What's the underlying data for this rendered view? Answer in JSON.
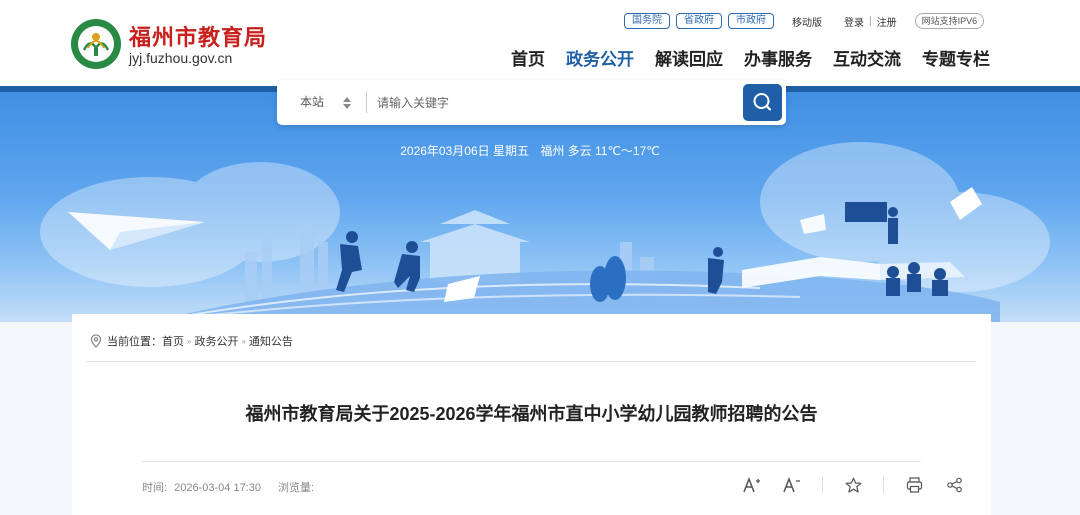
{
  "header": {
    "site_name": "福州市教育局",
    "site_domain": "jyj.fuzhou.gov.cn",
    "gov_links": [
      "国务院",
      "省政府",
      "市政府"
    ],
    "mobile": "移动版",
    "login": "登录",
    "separator": "|",
    "register": "注册",
    "ipv6": "网站支持IPV6",
    "nav": [
      {
        "label": "首页",
        "active": false
      },
      {
        "label": "政务公开",
        "active": true
      },
      {
        "label": "解读回应",
        "active": false
      },
      {
        "label": "办事服务",
        "active": false
      },
      {
        "label": "互动交流",
        "active": false
      },
      {
        "label": "专题专栏",
        "active": false
      }
    ],
    "accent_color": "#1f5fa8",
    "brand_red": "#c8201c"
  },
  "banner": {
    "date": "2026年03月06日 星期五",
    "weather": "福州 多云 11℃～17℃"
  },
  "search": {
    "scope": "本站",
    "placeholder": "请输入关键字",
    "icons": [
      "updown-arrow-icon",
      "search-icon"
    ]
  },
  "breadcrumb": {
    "label": "当前位置：",
    "items": [
      "首页",
      "政务公开",
      "通知公告"
    ],
    "separator": "»"
  },
  "article": {
    "title": "福州市教育局关于2025-2026学年福州市直中小学幼儿园教师招聘的公告",
    "time_label": "时间:",
    "time": "2026-03-04 17:30",
    "views_label": "浏览量:",
    "tools": [
      {
        "name": "font-larger",
        "label": "A⁺"
      },
      {
        "name": "font-smaller",
        "label": "A⁻"
      },
      {
        "name": "favorite",
        "icon": "star-icon"
      },
      {
        "name": "print",
        "icon": "print-icon"
      },
      {
        "name": "share",
        "icon": "share-icon"
      }
    ]
  }
}
